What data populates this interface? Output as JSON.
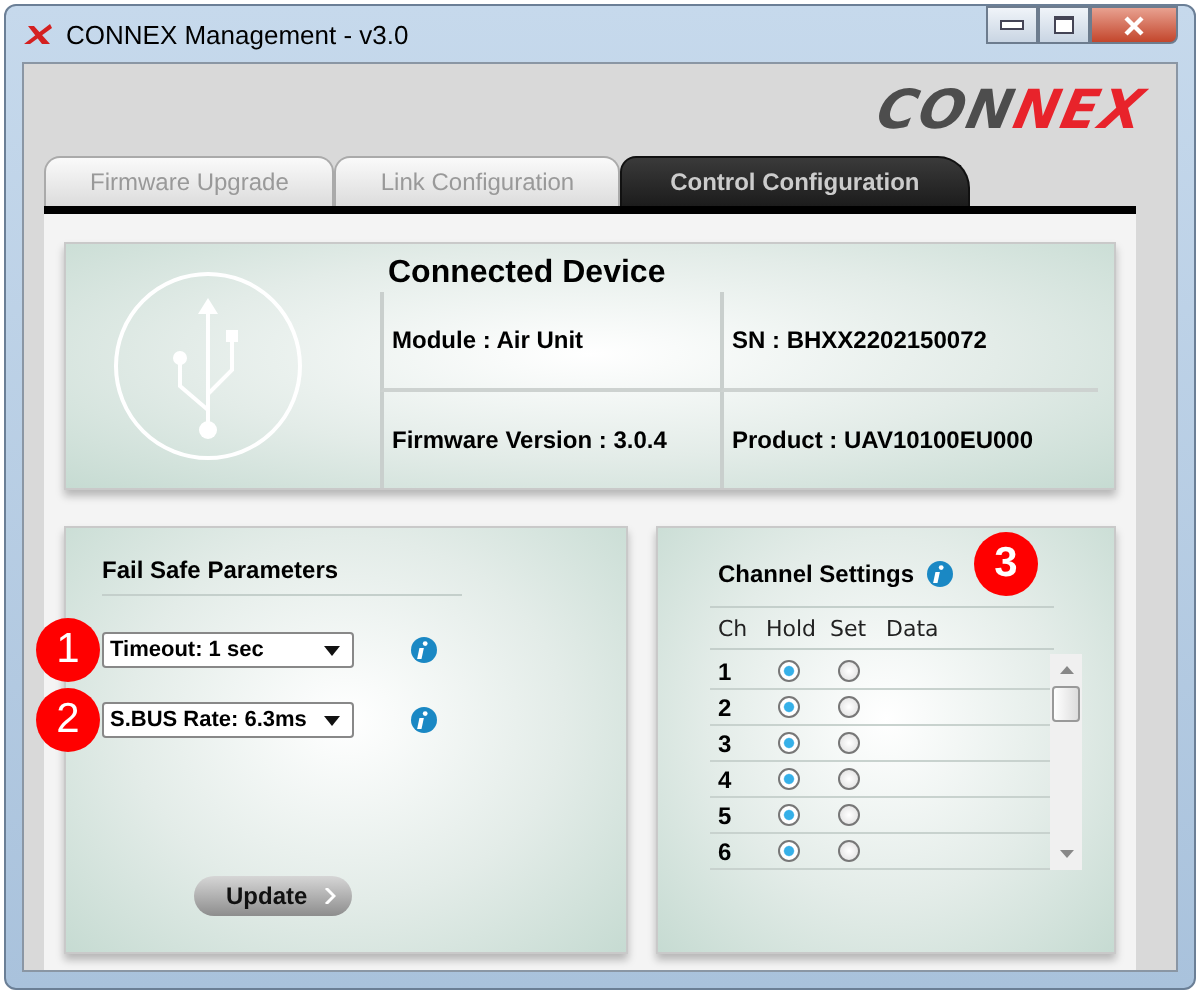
{
  "window": {
    "title": "CONNEX Management - v3.0"
  },
  "logo": {
    "gray_part": "CON",
    "red_part": "NEX"
  },
  "tabs": [
    {
      "label": "Firmware Upgrade",
      "selected": false
    },
    {
      "label": "Link Configuration",
      "selected": false
    },
    {
      "label": "Control Configuration",
      "selected": true
    }
  ],
  "device": {
    "title": "Connected Device",
    "fields": [
      "Module : Air Unit",
      "SN : BHXX2202150072",
      "Firmware Version : 3.0.4",
      "Product : UAV10100EU000"
    ]
  },
  "fail_safe": {
    "title": "Fail Safe Parameters",
    "dropdowns": [
      {
        "value": "Timeout: 1 sec",
        "badge": "1"
      },
      {
        "value": "S.BUS Rate: 6.3ms",
        "badge": "2"
      }
    ],
    "button": "Update"
  },
  "channel_settings": {
    "title": "Channel Settings",
    "badge": "3",
    "columns": [
      "Ch",
      "Hold",
      "Set",
      "Data"
    ],
    "rows": [
      {
        "ch": "1",
        "hold": true,
        "set": false
      },
      {
        "ch": "2",
        "hold": true,
        "set": false
      },
      {
        "ch": "3",
        "hold": true,
        "set": false
      },
      {
        "ch": "4",
        "hold": true,
        "set": false
      },
      {
        "ch": "5",
        "hold": true,
        "set": false
      },
      {
        "ch": "6",
        "hold": true,
        "set": false
      }
    ]
  }
}
